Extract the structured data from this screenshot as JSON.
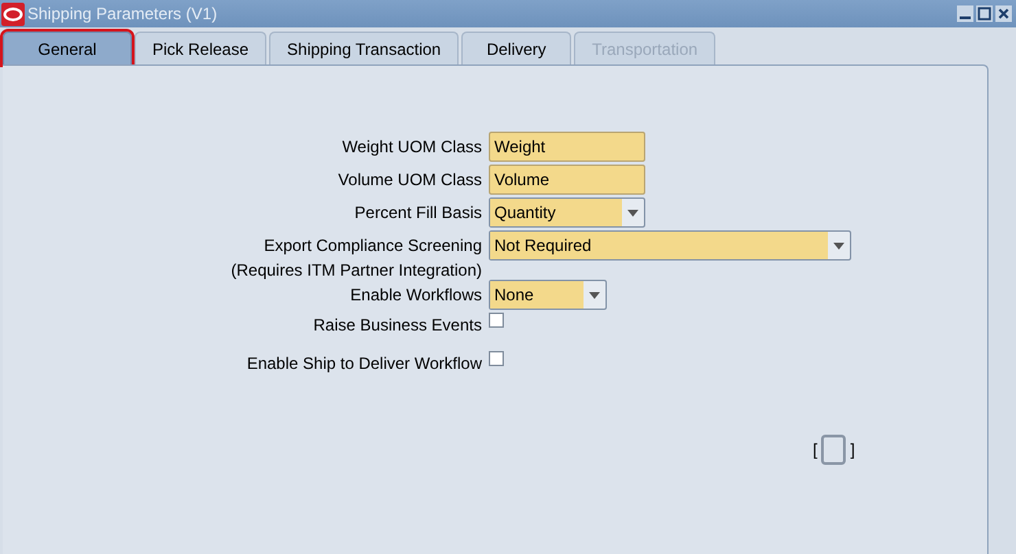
{
  "window": {
    "title": "Shipping Parameters (V1)"
  },
  "tabs": [
    {
      "label": "General",
      "selected": true,
      "disabled": false,
      "highlighted": true
    },
    {
      "label": "Pick Release",
      "selected": false,
      "disabled": false,
      "highlighted": false
    },
    {
      "label": "Shipping Transaction",
      "selected": false,
      "disabled": false,
      "highlighted": false
    },
    {
      "label": "Delivery",
      "selected": false,
      "disabled": false,
      "highlighted": false
    },
    {
      "label": "Transportation",
      "selected": false,
      "disabled": true,
      "highlighted": false
    }
  ],
  "fields": [
    {
      "kind": "text",
      "label": "Weight UOM Class",
      "value": "Weight"
    },
    {
      "kind": "text",
      "label": "Volume UOM Class",
      "value": "Volume"
    },
    {
      "kind": "select",
      "label": "Percent Fill Basis",
      "value": "Quantity"
    },
    {
      "kind": "select",
      "label": "Export Compliance Screening",
      "note": "(Requires ITM Partner Integration)",
      "value": "Not Required"
    },
    {
      "kind": "select",
      "label": "Enable Workflows",
      "value": "None"
    },
    {
      "kind": "checkbox",
      "label": "Raise Business Events",
      "checked": false
    },
    {
      "kind": "checkbox",
      "label": "Enable Ship to Deliver Workflow",
      "checked": false
    }
  ],
  "flex_field": {
    "open_bracket": "[",
    "close_bracket": "]"
  }
}
